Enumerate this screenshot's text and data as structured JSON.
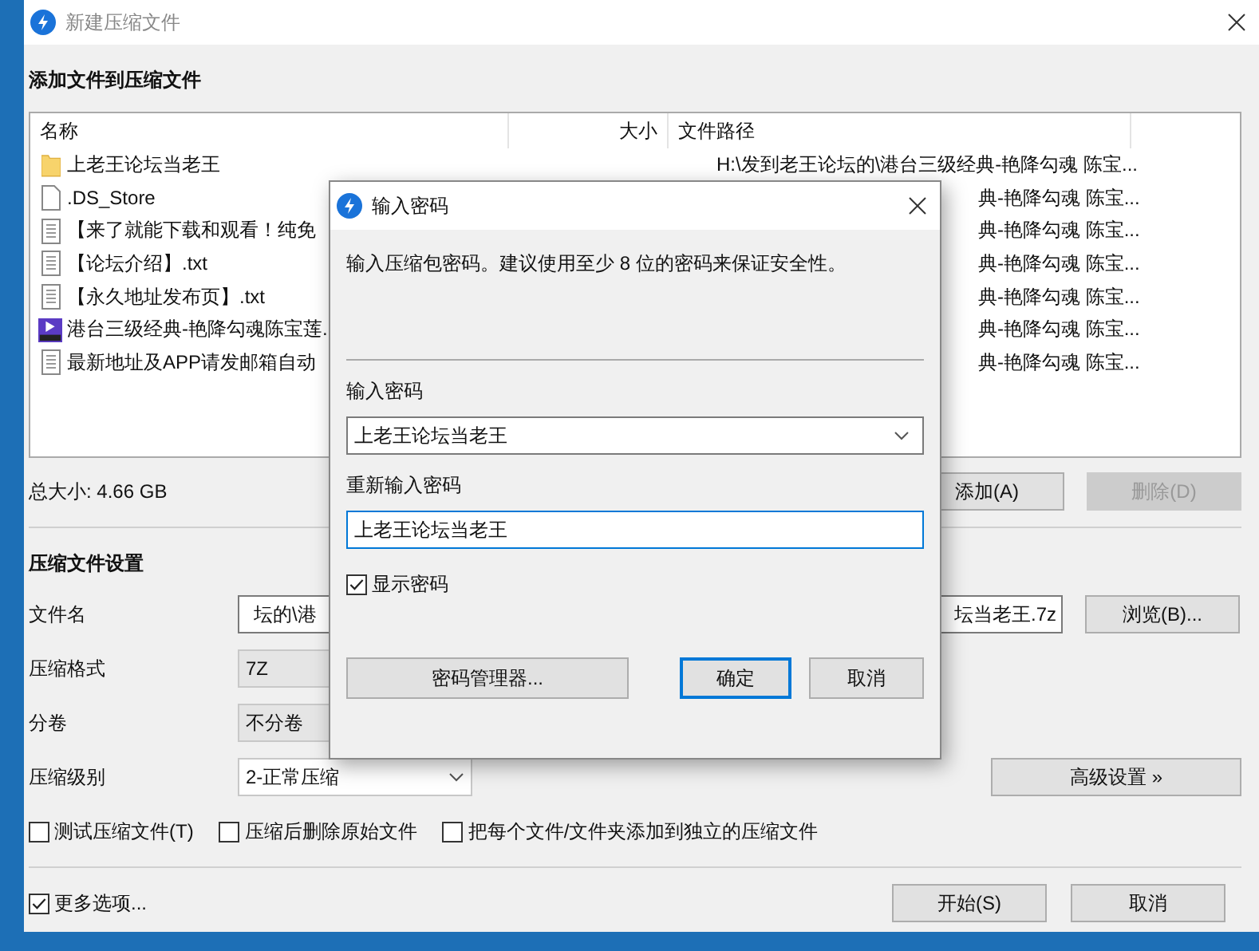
{
  "window": {
    "title": "新建压缩文件"
  },
  "files": {
    "title": "添加文件到压缩文件",
    "columns": [
      "名称",
      "大小",
      "文件路径"
    ],
    "rows": [
      {
        "kind": "folder",
        "name": "上老王论坛当老王",
        "path": "H:\\发到老王论坛的\\港台三级经典-艳降勾魂 陈宝...",
        "covered": false
      },
      {
        "kind": "blank",
        "name": ".DS_Store",
        "path": "典-艳降勾魂 陈宝...",
        "covered": true
      },
      {
        "kind": "text",
        "name": "【来了就能下载和观看！纯免",
        "path": "典-艳降勾魂 陈宝...",
        "covered": true
      },
      {
        "kind": "text",
        "name": "【论坛介绍】.txt",
        "path": "典-艳降勾魂 陈宝...",
        "covered": true
      },
      {
        "kind": "text",
        "name": "【永久地址发布页】.txt",
        "path": "典-艳降勾魂 陈宝...",
        "covered": true
      },
      {
        "kind": "video",
        "name": "港台三级经典-艳降勾魂陈宝莲.",
        "path": "典-艳降勾魂 陈宝...",
        "covered": true
      },
      {
        "kind": "text",
        "name": "最新地址及APP请发邮箱自动",
        "path": "典-艳降勾魂 陈宝...",
        "covered": true
      }
    ]
  },
  "total_size": "总大小: 4.66 GB",
  "list_buttons": [
    {
      "label": "添加(A)",
      "disabled": false
    },
    {
      "label": "删除(D)",
      "disabled": true
    }
  ],
  "settings": {
    "title": "压缩文件设置",
    "filename": {
      "label": "文件名",
      "value_start": "坛的\\港",
      "value_end": "坛当老王.7z",
      "browse": "浏览(B)..."
    },
    "format": {
      "label": "压缩格式",
      "value": "7Z",
      "disabled": true
    },
    "split": {
      "label": "分卷",
      "value": "不分卷",
      "disabled": true
    },
    "level": {
      "label": "压缩级别",
      "value": "2-正常压缩",
      "disabled": false
    },
    "advanced": "高级设置 »"
  },
  "options": [
    {
      "label": "测试压缩文件(T)",
      "checked": false
    },
    {
      "label": "压缩后删除原始文件",
      "checked": false
    },
    {
      "label": "把每个文件/文件夹添加到独立的压缩文件",
      "checked": false
    }
  ],
  "more_options": {
    "label": "更多选项...",
    "checked": true
  },
  "footer_buttons": [
    "开始(S)",
    "取消"
  ],
  "dialog": {
    "title": "输入密码",
    "description": "输入压缩包密码。建议使用至少 8 位的密码来保证安全性。",
    "password_label": "输入密码",
    "password": "上老王论坛当老王",
    "confirm_label": "重新输入密码",
    "confirm": "上老王论坛当老王",
    "show_password": {
      "label": "显示密码",
      "checked": true
    },
    "manager_button": "密码管理器...",
    "ok_button": "确定",
    "cancel_button": "取消"
  }
}
